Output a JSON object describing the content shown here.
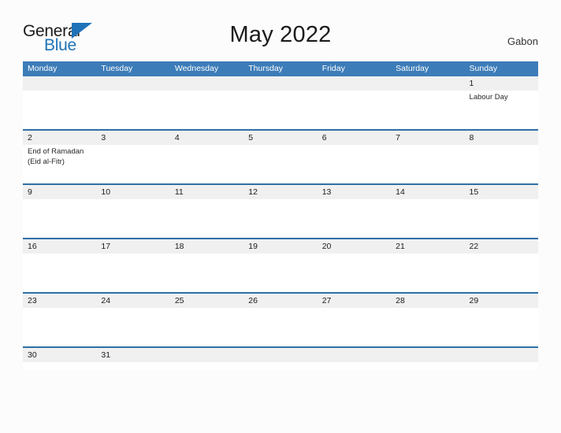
{
  "brand": {
    "name_part1": "General",
    "name_part2": "Blue",
    "triangle_icon": "triangle-icon",
    "accent_color": "#1f72b8"
  },
  "header": {
    "title": "May 2022",
    "country": "Gabon"
  },
  "calendar": {
    "header_bg": "#3c7cb8",
    "row_rule_color": "#2f6fa8",
    "day_band_color": "#f0f0f0",
    "weekdays": [
      "Monday",
      "Tuesday",
      "Wednesday",
      "Thursday",
      "Friday",
      "Saturday",
      "Sunday"
    ],
    "weeks": [
      {
        "days": [
          {
            "number": "",
            "events": []
          },
          {
            "number": "",
            "events": []
          },
          {
            "number": "",
            "events": []
          },
          {
            "number": "",
            "events": []
          },
          {
            "number": "",
            "events": []
          },
          {
            "number": "",
            "events": []
          },
          {
            "number": "1",
            "events": [
              "Labour Day"
            ]
          }
        ]
      },
      {
        "days": [
          {
            "number": "2",
            "events": [
              "End of Ramadan",
              "(Eid al-Fitr)"
            ]
          },
          {
            "number": "3",
            "events": []
          },
          {
            "number": "4",
            "events": []
          },
          {
            "number": "5",
            "events": []
          },
          {
            "number": "6",
            "events": []
          },
          {
            "number": "7",
            "events": []
          },
          {
            "number": "8",
            "events": []
          }
        ]
      },
      {
        "days": [
          {
            "number": "9",
            "events": []
          },
          {
            "number": "10",
            "events": []
          },
          {
            "number": "11",
            "events": []
          },
          {
            "number": "12",
            "events": []
          },
          {
            "number": "13",
            "events": []
          },
          {
            "number": "14",
            "events": []
          },
          {
            "number": "15",
            "events": []
          }
        ]
      },
      {
        "days": [
          {
            "number": "16",
            "events": []
          },
          {
            "number": "17",
            "events": []
          },
          {
            "number": "18",
            "events": []
          },
          {
            "number": "19",
            "events": []
          },
          {
            "number": "20",
            "events": []
          },
          {
            "number": "21",
            "events": []
          },
          {
            "number": "22",
            "events": []
          }
        ]
      },
      {
        "days": [
          {
            "number": "23",
            "events": []
          },
          {
            "number": "24",
            "events": []
          },
          {
            "number": "25",
            "events": []
          },
          {
            "number": "26",
            "events": []
          },
          {
            "number": "27",
            "events": []
          },
          {
            "number": "28",
            "events": []
          },
          {
            "number": "29",
            "events": []
          }
        ]
      },
      {
        "days": [
          {
            "number": "30",
            "events": []
          },
          {
            "number": "31",
            "events": []
          },
          {
            "number": "",
            "events": []
          },
          {
            "number": "",
            "events": []
          },
          {
            "number": "",
            "events": []
          },
          {
            "number": "",
            "events": []
          },
          {
            "number": "",
            "events": []
          }
        ]
      }
    ]
  }
}
